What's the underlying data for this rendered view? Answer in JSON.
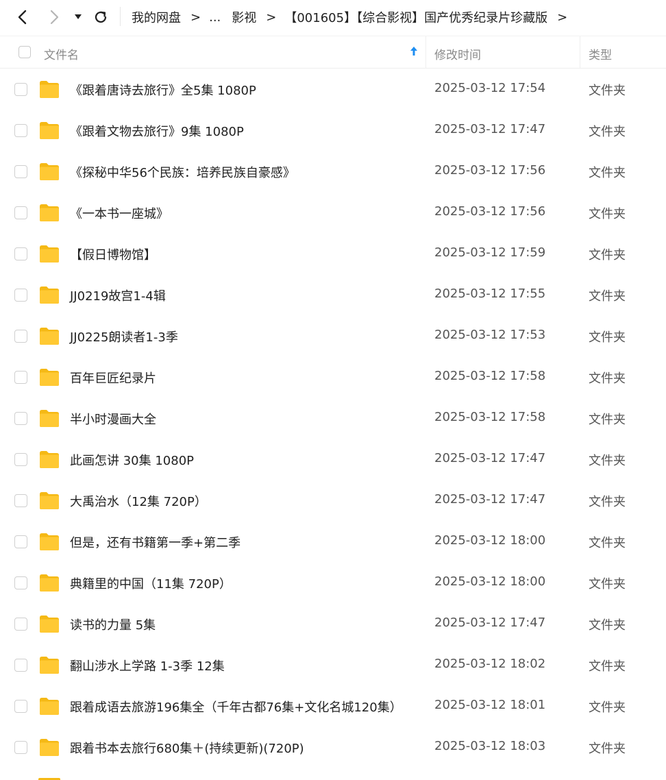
{
  "nav": {
    "back_icon": "chevron-left-icon",
    "forward_icon": "chevron-right-icon",
    "dropdown_icon": "triangle-down-icon",
    "refresh_icon": "refresh-icon"
  },
  "breadcrumb": {
    "root": "我的网盘",
    "ellipsis": "...",
    "parent": "影视",
    "current": "【001605】【综合影视】国产优秀纪录片珍藏版",
    "separator": ">"
  },
  "columns": {
    "name": "文件名",
    "sort_icon": "arrow-up-icon",
    "time": "修改时间",
    "type": "类型"
  },
  "colors": {
    "folder": "#FFC933",
    "sort_arrow": "#1f8ef1"
  },
  "files": [
    {
      "name": "《跟着唐诗去旅行》全5集 1080P",
      "time": "2025-03-12 17:54",
      "type": "文件夹"
    },
    {
      "name": "《跟着文物去旅行》9集 1080P",
      "time": "2025-03-12 17:47",
      "type": "文件夹"
    },
    {
      "name": "《探秘中华56个民族：培养民族自豪感》",
      "time": "2025-03-12 17:56",
      "type": "文件夹"
    },
    {
      "name": "《一本书一座城》",
      "time": "2025-03-12 17:56",
      "type": "文件夹"
    },
    {
      "name": "【假日博物馆】",
      "time": "2025-03-12 17:59",
      "type": "文件夹"
    },
    {
      "name": "JJ0219故宫1-4辑",
      "time": "2025-03-12 17:55",
      "type": "文件夹"
    },
    {
      "name": "JJ0225朗读者1-3季",
      "time": "2025-03-12 17:53",
      "type": "文件夹"
    },
    {
      "name": "百年巨匠纪录片",
      "time": "2025-03-12 17:58",
      "type": "文件夹"
    },
    {
      "name": "半小时漫画大全",
      "time": "2025-03-12 17:58",
      "type": "文件夹"
    },
    {
      "name": "此画怎讲 30集 1080P",
      "time": "2025-03-12 17:47",
      "type": "文件夹"
    },
    {
      "name": "大禹治水（12集 720P）",
      "time": "2025-03-12 17:47",
      "type": "文件夹"
    },
    {
      "name": "但是，还有书籍第一季+第二季",
      "time": "2025-03-12 18:00",
      "type": "文件夹"
    },
    {
      "name": "典籍里的中国（11集 720P）",
      "time": "2025-03-12 18:00",
      "type": "文件夹"
    },
    {
      "name": "读书的力量 5集",
      "time": "2025-03-12 17:47",
      "type": "文件夹"
    },
    {
      "name": "翻山涉水上学路 1-3季 12集",
      "time": "2025-03-12 18:02",
      "type": "文件夹"
    },
    {
      "name": "跟着成语去旅游196集全（千年古都76集+文化名城120集）",
      "time": "2025-03-12 18:01",
      "type": "文件夹"
    },
    {
      "name": "跟着书本去旅行680集＋(持续更新)(720P)",
      "time": "2025-03-12 18:03",
      "type": "文件夹"
    }
  ]
}
